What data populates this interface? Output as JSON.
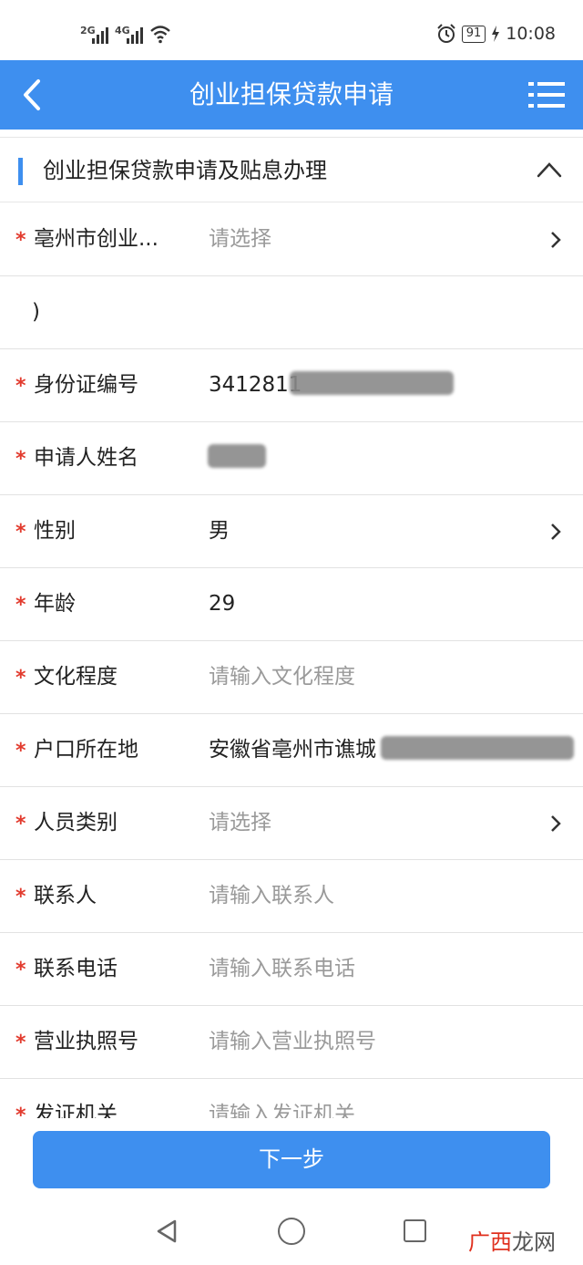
{
  "status": {
    "sig1": "2G",
    "sig2": "4G",
    "battery": "91",
    "time": "10:08"
  },
  "header": {
    "title": "创业担保贷款申请"
  },
  "section": {
    "title": "创业担保贷款申请及贴息办理"
  },
  "rows": [
    {
      "label": "亳州市创业...",
      "value": "",
      "placeholder": "请选择"
    },
    {
      "label": "",
      "value": ")",
      "placeholder": ""
    },
    {
      "label": "身份证编号",
      "value": "3412811",
      "placeholder": ""
    },
    {
      "label": "申请人姓名",
      "value": "",
      "placeholder": ""
    },
    {
      "label": "性别",
      "value": "男",
      "placeholder": ""
    },
    {
      "label": "年龄",
      "value": "29",
      "placeholder": ""
    },
    {
      "label": "文化程度",
      "value": "",
      "placeholder": "请输入文化程度"
    },
    {
      "label": "户口所在地",
      "value": "安徽省亳州市谯城",
      "placeholder": ""
    },
    {
      "label": "人员类别",
      "value": "",
      "placeholder": "请选择"
    },
    {
      "label": "联系人",
      "value": "",
      "placeholder": "请输入联系人"
    },
    {
      "label": "联系电话",
      "value": "",
      "placeholder": "请输入联系电话"
    },
    {
      "label": "营业执照号",
      "value": "",
      "placeholder": "请输入营业执照号"
    },
    {
      "label": "发证机关",
      "value": "",
      "placeholder": "请输入发证机关"
    }
  ],
  "footer": {
    "next_label": "下一步"
  },
  "watermark": {
    "accent": "广西",
    "rest": "龙网"
  },
  "colors": {
    "accent": "#3e8fef",
    "required": "#e23b2e"
  },
  "icons": {
    "back": "chevron-left-icon",
    "menu": "list-menu-icon",
    "collapse": "chevron-up-icon",
    "row_arrow": "chevron-right-icon"
  }
}
